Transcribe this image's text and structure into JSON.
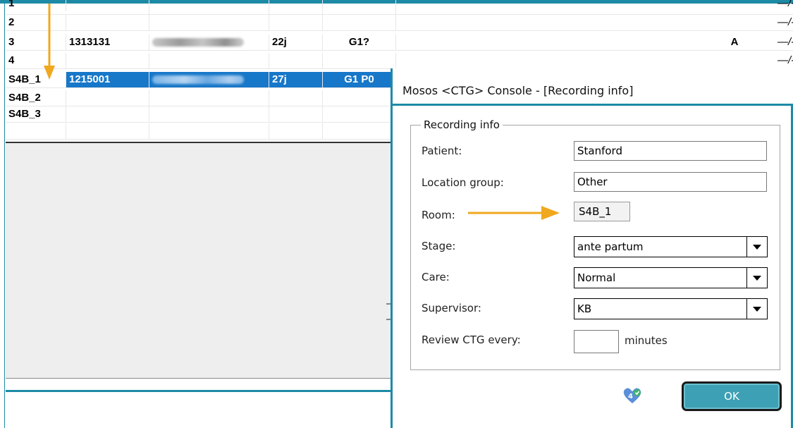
{
  "grid": {
    "rows": [
      {
        "c0": "1",
        "c1": "",
        "c3": "",
        "c4": "",
        "mark": "",
        "dash": "—/-"
      },
      {
        "c0": "2",
        "c1": "",
        "c3": "",
        "c4": "",
        "mark": "",
        "dash": "—/-"
      },
      {
        "c0": "3",
        "c1": "1313131",
        "c3": "22j",
        "c4": "G1?",
        "mark": "A",
        "dash": "—/-"
      },
      {
        "c0": "4",
        "c1": "",
        "c3": "",
        "c4": "",
        "mark": "",
        "dash": "—/-"
      },
      {
        "c0": "S4B_1",
        "c1": "1215001",
        "c3": "27j",
        "c4": "G1 P0",
        "mark": "",
        "dash": ""
      },
      {
        "c0": "S4B_2",
        "c1": "",
        "c3": "",
        "c4": "",
        "mark": "",
        "dash": ""
      },
      {
        "c0": "S4B_3",
        "c1": "",
        "c3": "",
        "c4": "",
        "mark": "",
        "dash": ""
      }
    ]
  },
  "dialog": {
    "title": "Mosos <CTG> Console - [Recording info]",
    "group_title": "Recording info",
    "patient_label": "Patient:",
    "patient_value": "Stanford",
    "location_label": "Location group:",
    "location_value": "Other",
    "room_label": "Room:",
    "room_value": "S4B_1",
    "stage_label": "Stage:",
    "stage_value": "ante partum",
    "care_label": "Care:",
    "care_value": "Normal",
    "supervisor_label": "Supervisor:",
    "supervisor_value": "KB",
    "review_label": "Review CTG every:",
    "review_value": "",
    "review_unit": "minutes",
    "ok_label": "OK"
  },
  "colors": {
    "frame": "#1d8aa6",
    "selection": "#1777c8",
    "annotation_arrow": "#f0a81e",
    "ok_button": "#3da0b4"
  },
  "icons": {
    "annotation_down": "arrow-down-icon",
    "annotation_right": "arrow-right-icon",
    "app_logo": "app-logo-icon"
  }
}
